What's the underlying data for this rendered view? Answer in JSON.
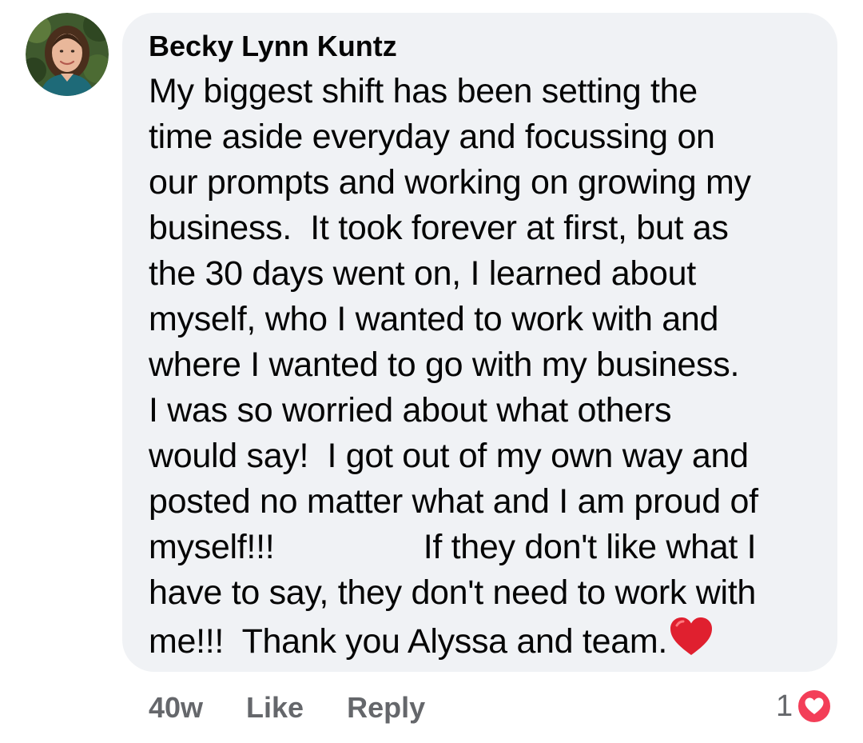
{
  "comment": {
    "author": "Becky Lynn Kuntz",
    "lines": [
      "My biggest shift has been setting the",
      "time aside everyday and focussing on",
      "our prompts and working on growing my",
      "business.  It took forever at first, but as",
      "the 30 days went on, I learned about",
      "myself, who I wanted to work with and",
      "where I wanted to go with my business.",
      "I was so worried about what others",
      "would say!  I got out of my own way and",
      "posted no matter what and I am proud of",
      "myself!!!                If they don't like what I",
      "have to say, they don't need to work with",
      "me!!!  Thank you Alyssa and team."
    ],
    "trailing_emoji": "red-heart-emoji",
    "colors": {
      "bubble": "#f0f2f5",
      "text": "#050505",
      "meta": "#65676b",
      "love_reaction": "#f33e58"
    }
  },
  "actions": {
    "time": "40w",
    "like_label": "Like",
    "reply_label": "Reply"
  },
  "reactions": {
    "count": "1",
    "icon": "love-reaction-icon"
  }
}
